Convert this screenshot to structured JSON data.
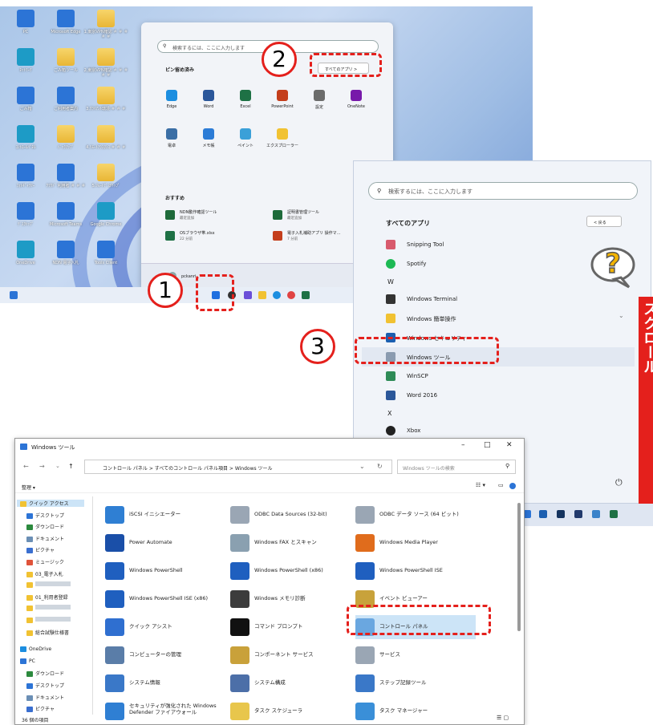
{
  "desktop": {
    "icons": [
      {
        "label": "PC"
      },
      {
        "label": "Microsoft Edge"
      },
      {
        "label": "1.東京VPN確認 ＃ ＃ ＃ ＃ ＃"
      },
      {
        "label": "ﾈｯﾄﾜｰｸ"
      },
      {
        "label": "ごみ箱ツール"
      },
      {
        "label": "2.東京VPN確認 ＃ ＃ ＃ ＃ ＃"
      },
      {
        "label": "ごみ箱"
      },
      {
        "label": "ご利用者案内"
      },
      {
        "label": "3.ｸﾗｲｱﾝﾄ環境 ＃ ＃ ＃"
      },
      {
        "label": "ｺﾝﾄﾛｰﾙﾊﾟﾈﾙ"
      },
      {
        "label": "ﾊﾞｯｸｱｯﾌﾟ"
      },
      {
        "label": "4.ﾘﾓｰﾄｱｼｽﾀﾝｽ ＃ ＃ ＃"
      },
      {
        "label": "ﾌｫﾄｷﾞｬﾗﾘｰ"
      },
      {
        "label": "ｸﾗｳﾄﾞ 利用者 ＃ ＃ ＃"
      },
      {
        "label": "5.ﾘﾓｰﾄﾃﾞｽｸﾄｯﾌﾟ"
      },
      {
        "label": "ﾃﾞｽｸﾄｯﾌﾟ"
      },
      {
        "label": "Microsoft Teams"
      },
      {
        "label": "Google Chrome"
      },
      {
        "label": "OneDrive"
      },
      {
        "label": "NDN 電子入札"
      },
      {
        "label": "Tools Client"
      }
    ],
    "start_menu": {
      "search_placeholder": "検索するには、ここに入力します",
      "pinned_heading": "ピン留め済み",
      "all_apps_button": "すべてのアプリ  >",
      "pinned": [
        {
          "label": "Edge"
        },
        {
          "label": "Word"
        },
        {
          "label": "Excel"
        },
        {
          "label": "PowerPoint"
        },
        {
          "label": "設定"
        },
        {
          "label": "OneNote"
        },
        {
          "label": "電卓"
        },
        {
          "label": "メモ帳"
        },
        {
          "label": "ペイント"
        },
        {
          "label": "エクスプローラー"
        }
      ],
      "recommended_heading": "おすすめ",
      "recommended": [
        {
          "title": "NDN動作確認ツール",
          "sub": "最近追加"
        },
        {
          "title": "証明書管理ツール",
          "sub": "最近追加"
        },
        {
          "title": "OSブラウザ帯.xlsx",
          "sub": "22 分前"
        },
        {
          "title": "電子入札補助アプリ 操作マ…",
          "sub": "7 分前"
        }
      ],
      "user": "pckanri"
    }
  },
  "all_apps": {
    "search_placeholder": "検索するには、ここに入力します",
    "heading": "すべてのアプリ",
    "back_button": "<  戻る",
    "items": [
      {
        "type": "app",
        "label": "Snipping Tool"
      },
      {
        "type": "app",
        "label": "Spotify"
      },
      {
        "type": "letter",
        "label": "W"
      },
      {
        "type": "app",
        "label": "Windows Terminal"
      },
      {
        "type": "app",
        "label": "Windows 簡単操作"
      },
      {
        "type": "app",
        "label": "Windows セキュリティ"
      },
      {
        "type": "app",
        "label": "Windows ツール"
      },
      {
        "type": "app",
        "label": "WinSCP"
      },
      {
        "type": "app",
        "label": "Word 2016"
      },
      {
        "type": "letter",
        "label": "X"
      },
      {
        "type": "app",
        "label": "Xbox"
      }
    ],
    "scroll_hint": "スクロール",
    "power_icon": "⏻"
  },
  "explorer": {
    "title": "Windows ツール",
    "address": "コントロール パネル  >  すべてのコントロール パネル項目  >  Windows ツール",
    "search_placeholder": "Windows ツールの検索",
    "organize": "整理 ▾",
    "sidebar": [
      {
        "label": "クイック アクセス"
      },
      {
        "label": "デスクトップ"
      },
      {
        "label": "ダウンロード"
      },
      {
        "label": "ドキュメント"
      },
      {
        "label": "ピクチャ"
      },
      {
        "label": "ミュージック"
      },
      {
        "label": "03_電子入札"
      },
      {
        "label": ""
      },
      {
        "label": "01_利用者登録"
      },
      {
        "label": ""
      },
      {
        "label": ""
      },
      {
        "label": "総合試験仕様書"
      },
      {
        "label": "OneDrive"
      },
      {
        "label": "PC"
      },
      {
        "label": "ダウンロード"
      },
      {
        "label": "デスクトップ"
      },
      {
        "label": "ドキュメント"
      },
      {
        "label": "ピクチャ"
      }
    ],
    "tools": [
      {
        "label": "iSCSI イニシエーター"
      },
      {
        "label": "ODBC Data Sources (32-bit)"
      },
      {
        "label": "ODBC データ ソース (64 ビット)"
      },
      {
        "label": "Power Automate"
      },
      {
        "label": "Windows FAX とスキャン"
      },
      {
        "label": "Windows Media Player"
      },
      {
        "label": "Windows PowerShell"
      },
      {
        "label": "Windows PowerShell (x86)"
      },
      {
        "label": "Windows PowerShell ISE"
      },
      {
        "label": "Windows PowerShell ISE (x86)"
      },
      {
        "label": "Windows メモリ診断"
      },
      {
        "label": "イベント ビューアー"
      },
      {
        "label": "クイック アシスト"
      },
      {
        "label": "コマンド プロンプト"
      },
      {
        "label": "コントロール パネル"
      },
      {
        "label": "コンピューターの管理"
      },
      {
        "label": "コンポーネント サービス"
      },
      {
        "label": "サービス"
      },
      {
        "label": "システム情報"
      },
      {
        "label": "システム構成"
      },
      {
        "label": "ステップ記録ツール"
      },
      {
        "label": "セキュリティが強化された Windows Defender ファイアウォール"
      },
      {
        "label": "タスク スケジューラ"
      },
      {
        "label": "タスク マネージャー"
      }
    ],
    "status": "36 個の項目"
  },
  "annotations": {
    "step1": "1",
    "step2": "2",
    "step3": "3"
  },
  "colors": {
    "accent": "#e4201c",
    "selection": "#cce4f7"
  }
}
